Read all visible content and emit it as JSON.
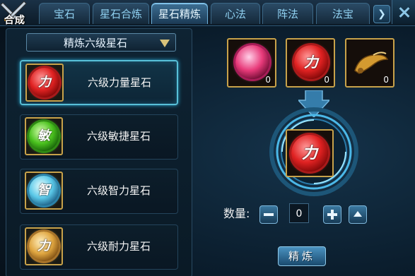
{
  "logo_text": "合成",
  "tabs": [
    {
      "label": "宝石",
      "active": false
    },
    {
      "label": "星石合炼",
      "active": false
    },
    {
      "label": "星石精炼",
      "active": true
    },
    {
      "label": "心法",
      "active": false
    },
    {
      "label": "阵法",
      "active": false
    },
    {
      "label": "法宝",
      "active": false
    }
  ],
  "dropdown": {
    "selected": "精炼六级星石"
  },
  "gem_list": [
    {
      "label": "六级力量星石",
      "char": "力",
      "color": "red",
      "selected": true
    },
    {
      "label": "六级敏捷星石",
      "char": "敏",
      "color": "green",
      "selected": false
    },
    {
      "label": "六级智力星石",
      "char": "智",
      "color": "blue",
      "selected": false
    },
    {
      "label": "六级耐力星石",
      "char": "力",
      "color": "gold",
      "selected": false
    }
  ],
  "materials": [
    {
      "name": "pink-gem",
      "count": "0"
    },
    {
      "name": "red-gem",
      "char": "力",
      "count": "0"
    },
    {
      "name": "horn-item",
      "count": "0"
    }
  ],
  "result": {
    "char": "力"
  },
  "quantity": {
    "label": "数量:",
    "value": "0"
  },
  "refine_button": "精炼",
  "colors": {
    "accent_blue": "#58c0d8",
    "gold_frame": "#c8a24a"
  }
}
